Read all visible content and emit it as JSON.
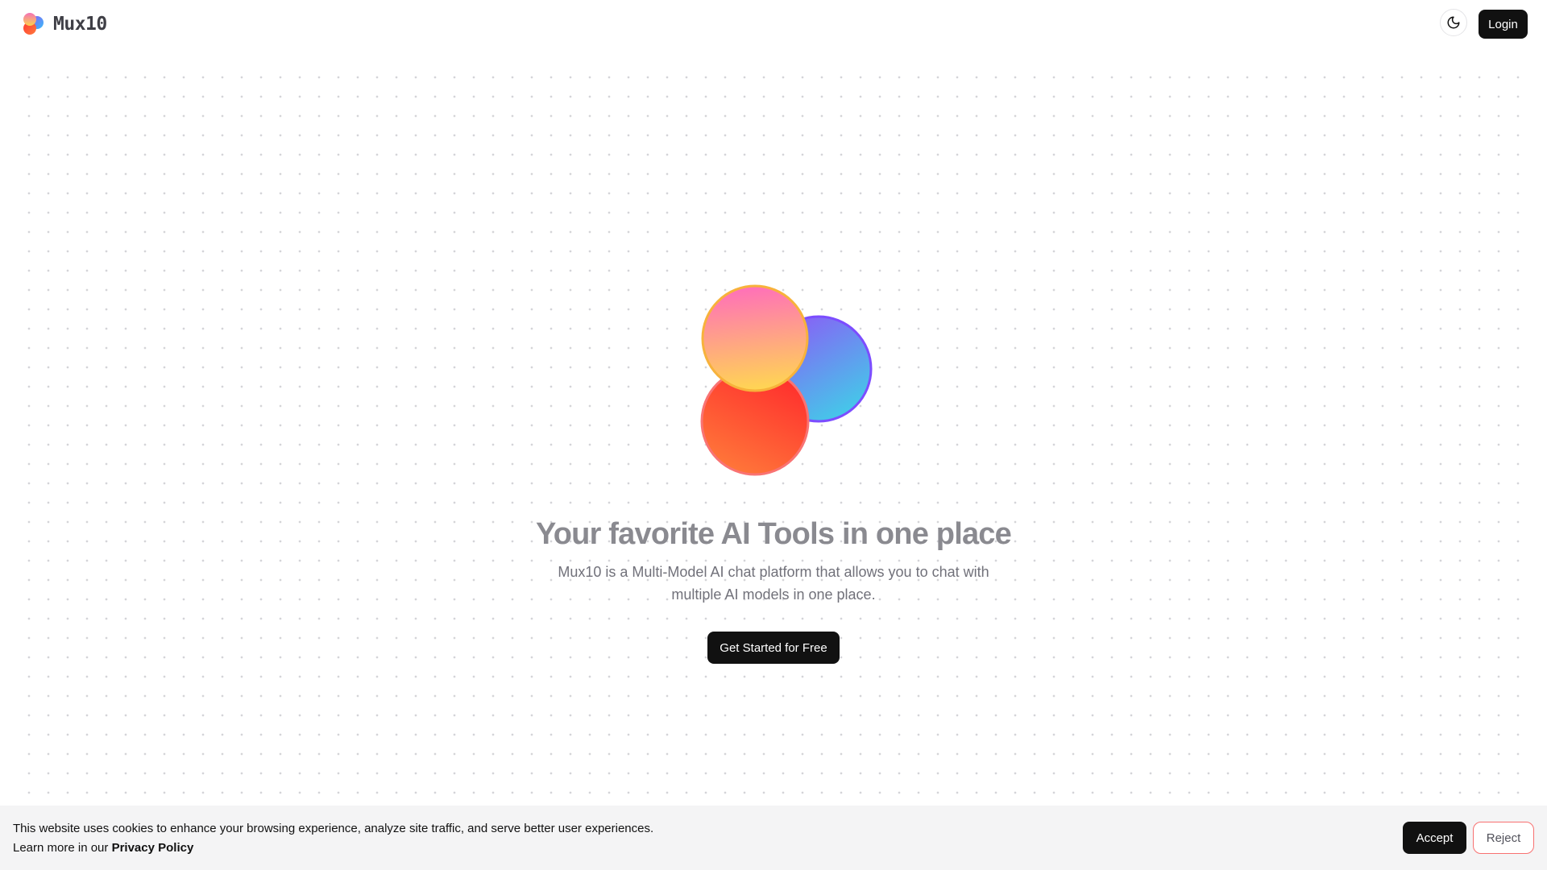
{
  "app": {
    "name": "Mux10"
  },
  "header": {
    "logo_icon": "mux10-logo-icon",
    "theme_icon": "moon-icon",
    "login_label": "Login"
  },
  "hero": {
    "art_icon": "mux10-logo-icon",
    "title": "Your favorite AI Tools in one place",
    "subtitle": "Mux10 is a Multi-Model AI chat platform that allows you to chat with multiple AI models in one place.",
    "cta_label": "Get Started for Free"
  },
  "cookie_banner": {
    "message": "This website uses cookies to enhance your browsing experience, analyze site traffic, and serve better user experiences.",
    "learn_more_prefix": "Learn more in our ",
    "privacy_link": "Privacy Policy",
    "accept_label": "Accept",
    "reject_label": "Reject"
  },
  "colors": {
    "primary": "#111111",
    "background": "#ffffff",
    "banner_background": "#f4f4f5",
    "reject_border": "#f87171"
  }
}
